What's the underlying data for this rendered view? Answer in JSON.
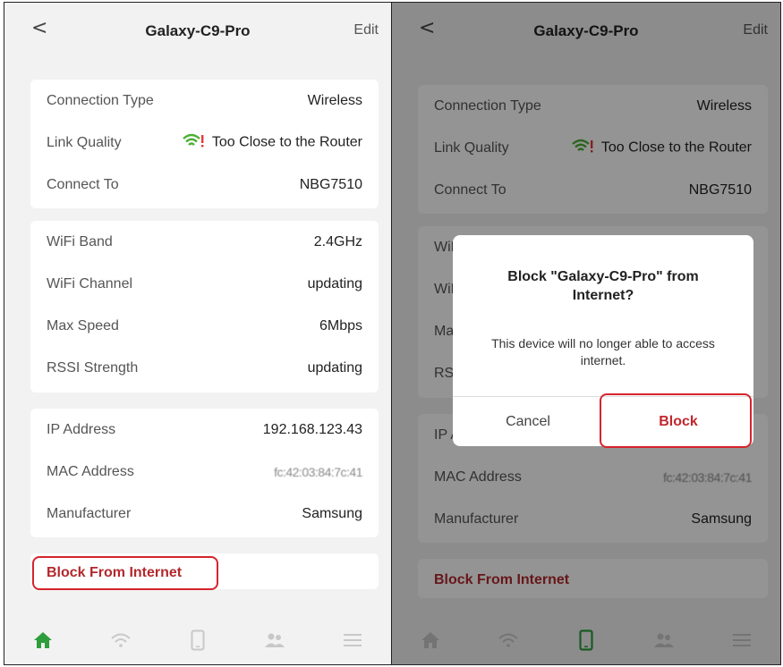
{
  "header": {
    "back_symbol": "<",
    "title": "Galaxy-C9-Pro",
    "edit_label": "Edit"
  },
  "connection": [
    {
      "label": "Connection Type",
      "value": "Wireless"
    },
    {
      "label": "Link Quality",
      "value": "Too Close to the Router",
      "icon": "wifi-warning-icon"
    },
    {
      "label": "Connect To",
      "value": "NBG7510"
    }
  ],
  "wifi": [
    {
      "label": "WiFi Band",
      "value": "2.4GHz"
    },
    {
      "label": "WiFi Channel",
      "value": "updating"
    },
    {
      "label": "Max Speed",
      "value": "6Mbps"
    },
    {
      "label": "RSSI Strength",
      "value": "updating"
    }
  ],
  "network": [
    {
      "label": "IP Address",
      "value": "192.168.123.43"
    },
    {
      "label": "MAC Address",
      "value": "fc:42:03:84:7c:41"
    },
    {
      "label": "Manufacturer",
      "value": "Samsung"
    }
  ],
  "block_action": {
    "label": "Block From Internet"
  },
  "tabbar": {
    "tabs": [
      "home-icon",
      "wifi-icon",
      "device-icon",
      "users-icon",
      "menu-icon"
    ],
    "active_left": "home-icon",
    "active_right": "device-icon"
  },
  "dialog": {
    "title": "Block \"Galaxy-C9-Pro\" from Internet?",
    "message": "This device will no longer able to access internet.",
    "cancel_label": "Cancel",
    "block_label": "Block"
  },
  "colors": {
    "accent_green": "#2e9e3c",
    "danger_red": "#b3282d",
    "highlight_red": "#d6242c",
    "wifi_green": "#4caf34",
    "wifi_warning": "#e53935"
  }
}
